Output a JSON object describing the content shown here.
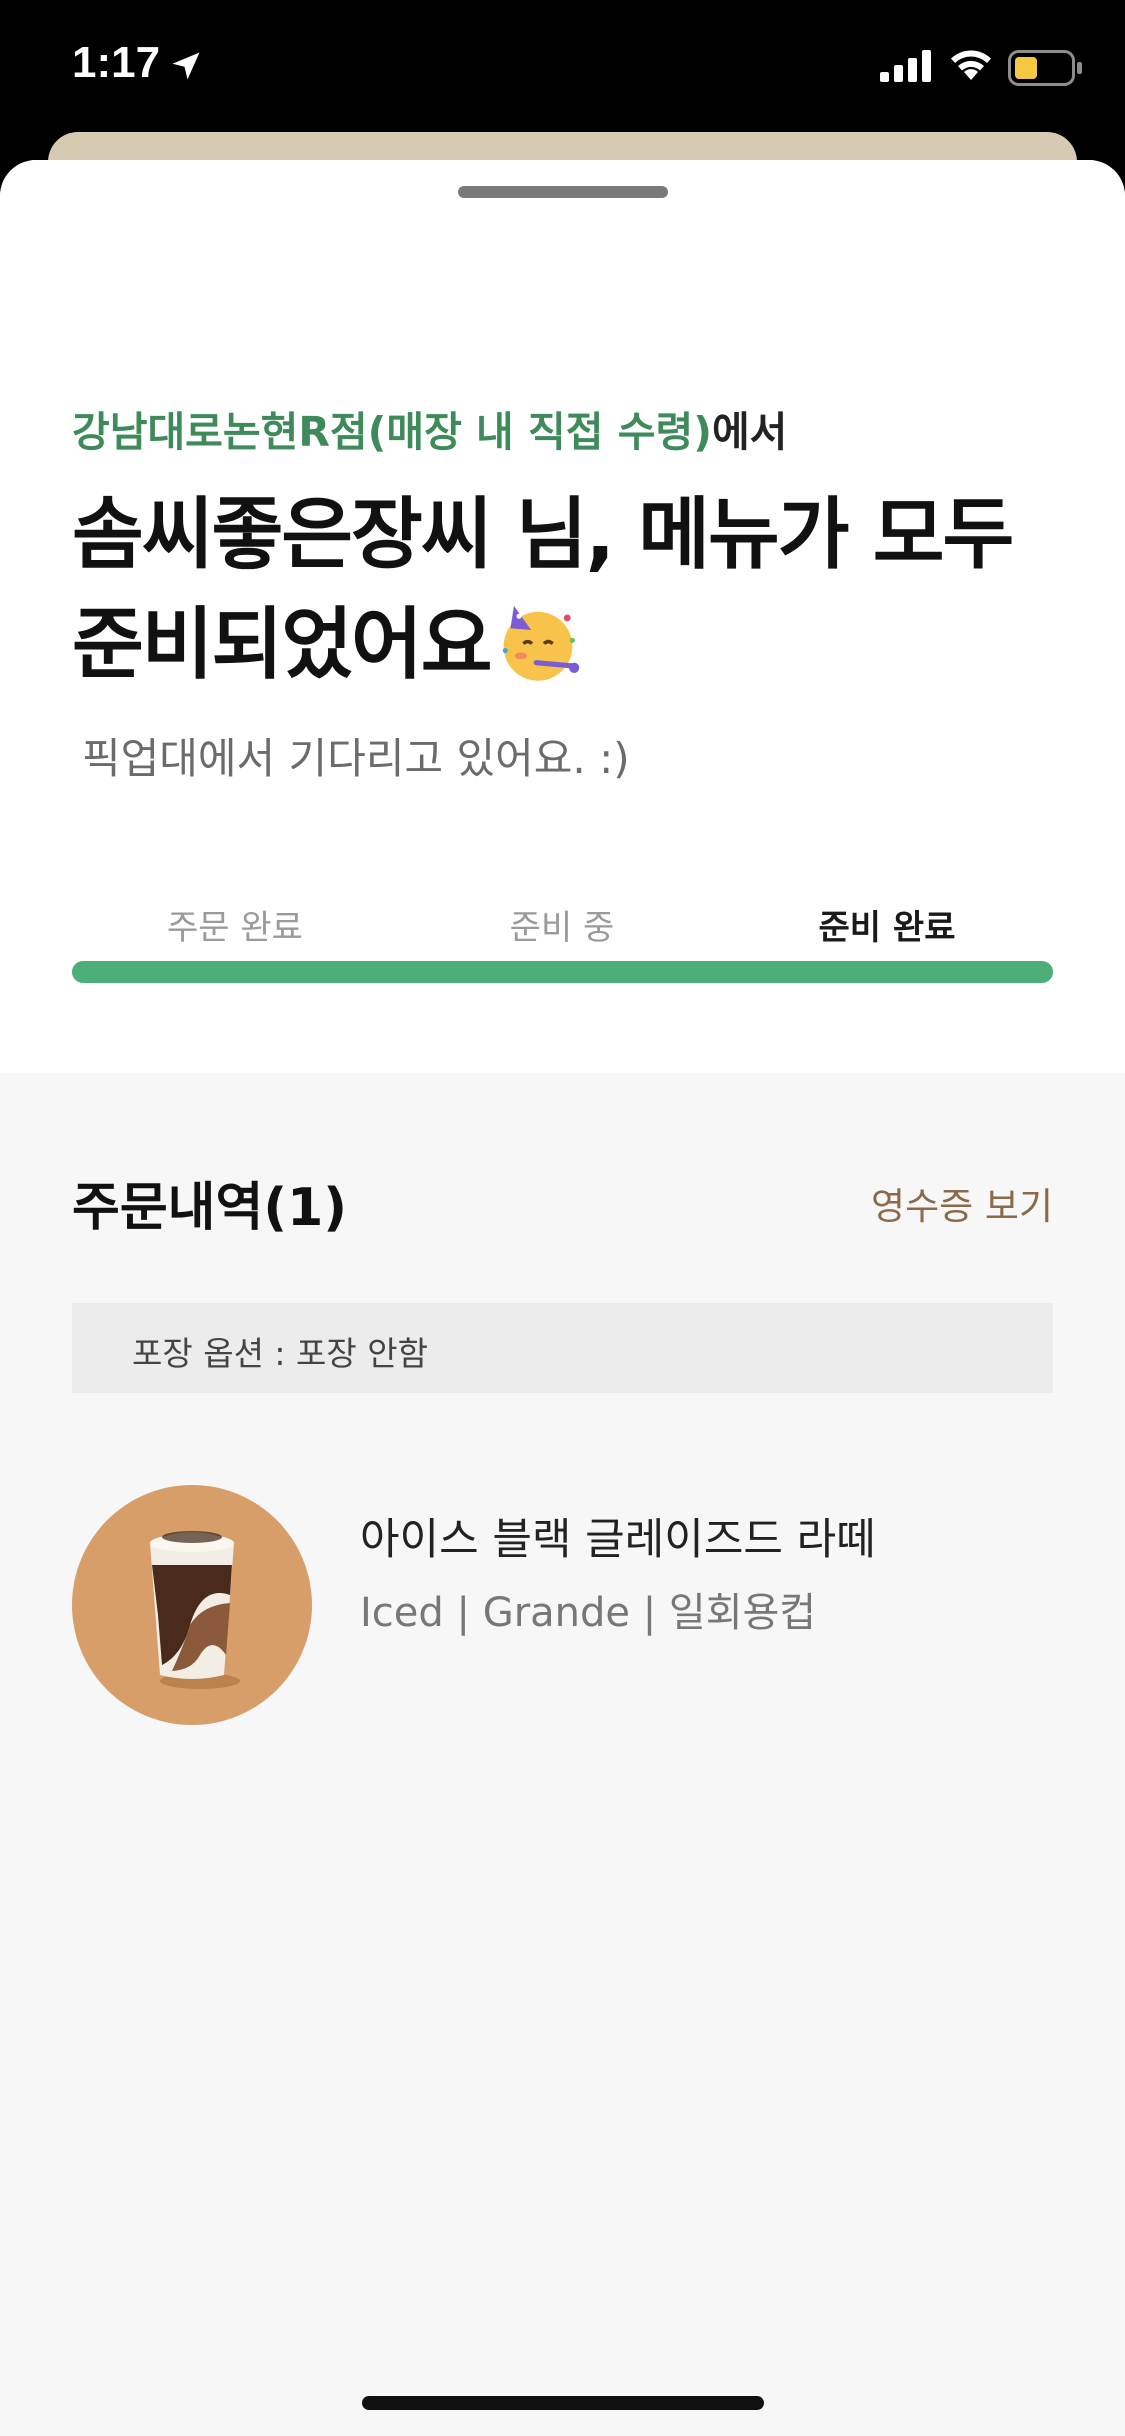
{
  "status_bar": {
    "time": "1:17",
    "battery_color": "#f5c842"
  },
  "order": {
    "store_name": "강남대로논현R점(매장 내 직접 수령)",
    "store_suffix": "에서",
    "headline_line1": "솜씨좋은장씨 님, 메뉴가 모두",
    "headline_line2": "준비되었어요",
    "headline_emoji": "partying-face-icon",
    "subtext": "픽업대에서 기다리고 있어요. :)",
    "steps": [
      "주문 완료",
      "준비 중",
      "준비 완료"
    ],
    "current_step": 3,
    "progress_fraction": 1.0
  },
  "history": {
    "title": "주문내역(1)",
    "receipt_label": "영수증 보기",
    "option_text": "포장 옵션 : 포장 안함",
    "items": [
      {
        "name": "아이스 블랙 글레이즈드 라떼",
        "detail": "Iced | Grande | 일회용컵",
        "icon": "iced-latte-icon"
      }
    ]
  },
  "colors": {
    "accent_green": "#3e8a5a",
    "progress_green": "#4caf78",
    "receipt_brown": "#8a6a48",
    "thumb_bg": "#d79e6a"
  }
}
